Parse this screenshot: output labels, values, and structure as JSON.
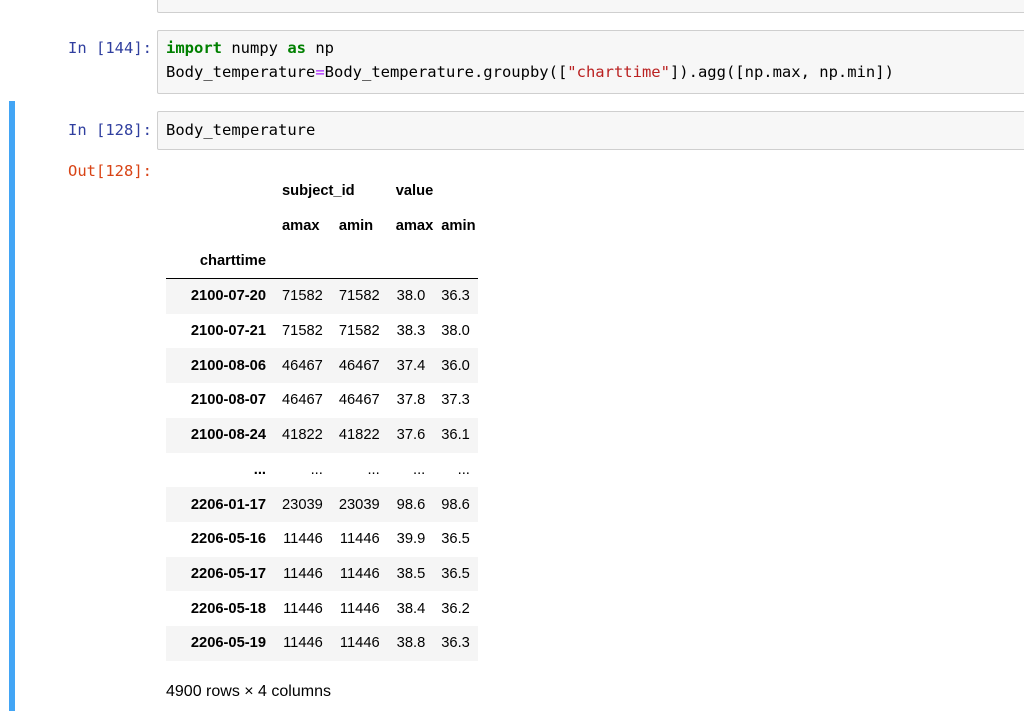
{
  "cells": [
    {
      "prompt": "In [144]:",
      "code_line1": {
        "kw1": "import",
        "t1": " numpy ",
        "kw2": "as",
        "t2": " np"
      },
      "code_line2": {
        "t1": "Body_temperature",
        "op": "=",
        "t2": "Body_temperature.groupby([",
        "str": "\"charttime\"",
        "t3": "]).agg([np.max, np.min])"
      }
    },
    {
      "prompt": "In [128]:",
      "code": "Body_temperature",
      "out_prompt": "Out[128]:"
    }
  ],
  "dataframe": {
    "top_headers": [
      "subject_id",
      "value"
    ],
    "sub_headers": [
      "amax",
      "amin",
      "amax",
      "amin"
    ],
    "index_name": "charttime",
    "rows": [
      {
        "index": "2100-07-20",
        "values": [
          "71582",
          "71582",
          "38.0",
          "36.3"
        ]
      },
      {
        "index": "2100-07-21",
        "values": [
          "71582",
          "71582",
          "38.3",
          "38.0"
        ]
      },
      {
        "index": "2100-08-06",
        "values": [
          "46467",
          "46467",
          "37.4",
          "36.0"
        ]
      },
      {
        "index": "2100-08-07",
        "values": [
          "46467",
          "46467",
          "37.8",
          "37.3"
        ]
      },
      {
        "index": "2100-08-24",
        "values": [
          "41822",
          "41822",
          "37.6",
          "36.1"
        ]
      },
      {
        "index": "...",
        "values": [
          "...",
          "...",
          "...",
          "..."
        ]
      },
      {
        "index": "2206-01-17",
        "values": [
          "23039",
          "23039",
          "98.6",
          "98.6"
        ]
      },
      {
        "index": "2206-05-16",
        "values": [
          "11446",
          "11446",
          "39.9",
          "36.5"
        ]
      },
      {
        "index": "2206-05-17",
        "values": [
          "11446",
          "11446",
          "38.5",
          "36.5"
        ]
      },
      {
        "index": "2206-05-18",
        "values": [
          "11446",
          "11446",
          "38.4",
          "36.2"
        ]
      },
      {
        "index": "2206-05-19",
        "values": [
          "11446",
          "11446",
          "38.8",
          "36.3"
        ]
      }
    ],
    "footer": "4900 rows × 4 columns"
  },
  "colors": {
    "in_prompt": "#303f9f",
    "out_prompt": "#d84315",
    "selected_bar": "#42a5f5",
    "keyword": "#008000",
    "string": "#ba2121"
  }
}
